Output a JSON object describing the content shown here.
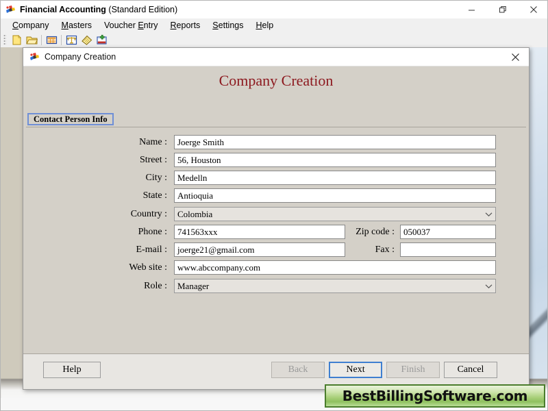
{
  "window": {
    "title_bold": "Financial Accounting",
    "title_rest": "(Standard Edition)",
    "app_icon": "app-puzzle-icon",
    "controls": {
      "minimize": "minimize-icon",
      "restore": "restore-icon",
      "close": "close-icon"
    }
  },
  "menu": {
    "items": [
      {
        "label": "Company",
        "mnemonic": "C"
      },
      {
        "label": "Masters",
        "mnemonic": "M"
      },
      {
        "label": "Voucher Entry",
        "mnemonic": "E"
      },
      {
        "label": "Reports",
        "mnemonic": "R"
      },
      {
        "label": "Settings",
        "mnemonic": "S"
      },
      {
        "label": "Help",
        "mnemonic": "H"
      }
    ]
  },
  "toolbar": {
    "buttons": [
      {
        "name": "new-document-icon"
      },
      {
        "name": "open-folder-icon"
      },
      {
        "name": "table-grid-icon"
      },
      {
        "name": "balance-scale-icon"
      },
      {
        "name": "ledger-book-icon"
      },
      {
        "name": "add-entry-icon"
      }
    ]
  },
  "dialog": {
    "titlebar_text": "Company Creation",
    "titlebar_icon": "dialog-puzzle-icon",
    "close_icon": "close-icon",
    "heading": "Company Creation",
    "tabs": [
      {
        "label": "Contact Person Info",
        "active": true
      }
    ],
    "fields": {
      "name": {
        "label": "Name :",
        "value": "Joerge Smith",
        "type": "text"
      },
      "street": {
        "label": "Street :",
        "value": "56, Houston",
        "type": "text"
      },
      "city": {
        "label": "City :",
        "value": "Medelln",
        "type": "text"
      },
      "state": {
        "label": "State :",
        "value": "Antioquia",
        "type": "text"
      },
      "country": {
        "label": "Country :",
        "value": "Colombia",
        "type": "select"
      },
      "phone": {
        "label": "Phone :",
        "value": "741563xxx",
        "type": "text"
      },
      "zip": {
        "label": "Zip code :",
        "value": "050037",
        "type": "text"
      },
      "email": {
        "label": "E-mail :",
        "value": "joerge21@gmail.com",
        "type": "text"
      },
      "fax": {
        "label": "Fax :",
        "value": "",
        "type": "text"
      },
      "website": {
        "label": "Web site :",
        "value": "www.abccompany.com",
        "type": "text"
      },
      "role": {
        "label": "Role :",
        "value": "Manager",
        "type": "select"
      }
    },
    "buttons": {
      "help": {
        "label": "Help",
        "state": "enabled"
      },
      "back": {
        "label": "Back",
        "state": "disabled"
      },
      "next": {
        "label": "Next",
        "state": "focused"
      },
      "finish": {
        "label": "Finish",
        "state": "disabled"
      },
      "cancel": {
        "label": "Cancel",
        "state": "enabled"
      }
    }
  },
  "watermark": {
    "text": "BestBillingSoftware.com",
    "border_color": "#4a7d2c",
    "text_color": "#111111"
  },
  "colors": {
    "heading": "#8d1a20",
    "dialog_bg": "#d4d0c8",
    "tab_border": "#6f8fd6",
    "focus_border": "#3f7fd0"
  }
}
